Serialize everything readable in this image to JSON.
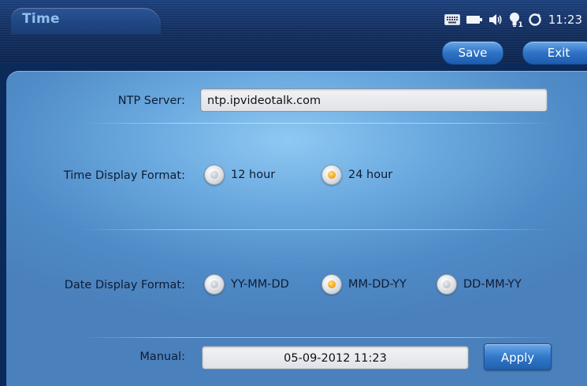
{
  "header": {
    "title": "Time",
    "status_icons": [
      "keyboard-icon",
      "battery-icon",
      "speaker-icon",
      "bulb-icon",
      "sync-icon"
    ],
    "bulb_badge": "1",
    "clock": "11:23"
  },
  "toolbar": {
    "save_label": "Save",
    "exit_label": "Exit"
  },
  "form": {
    "ntp_server": {
      "label": "NTP Server:",
      "value": "ntp.ipvideotalk.com"
    },
    "time_format": {
      "label": "Time Display Format:",
      "options": [
        {
          "label": "12 hour",
          "selected": false
        },
        {
          "label": "24 hour",
          "selected": true
        }
      ]
    },
    "date_format": {
      "label": "Date Display Format:",
      "options": [
        {
          "label": "YY-MM-DD",
          "selected": false
        },
        {
          "label": "MM-DD-YY",
          "selected": true
        },
        {
          "label": "DD-MM-YY",
          "selected": false
        }
      ]
    },
    "manual": {
      "label": "Manual:",
      "value": "05-09-2012 11:23",
      "apply_label": "Apply"
    }
  },
  "colors": {
    "accent": "#2f73c6",
    "selected_radio": "#f5a623",
    "panel": "#6aa9df"
  }
}
